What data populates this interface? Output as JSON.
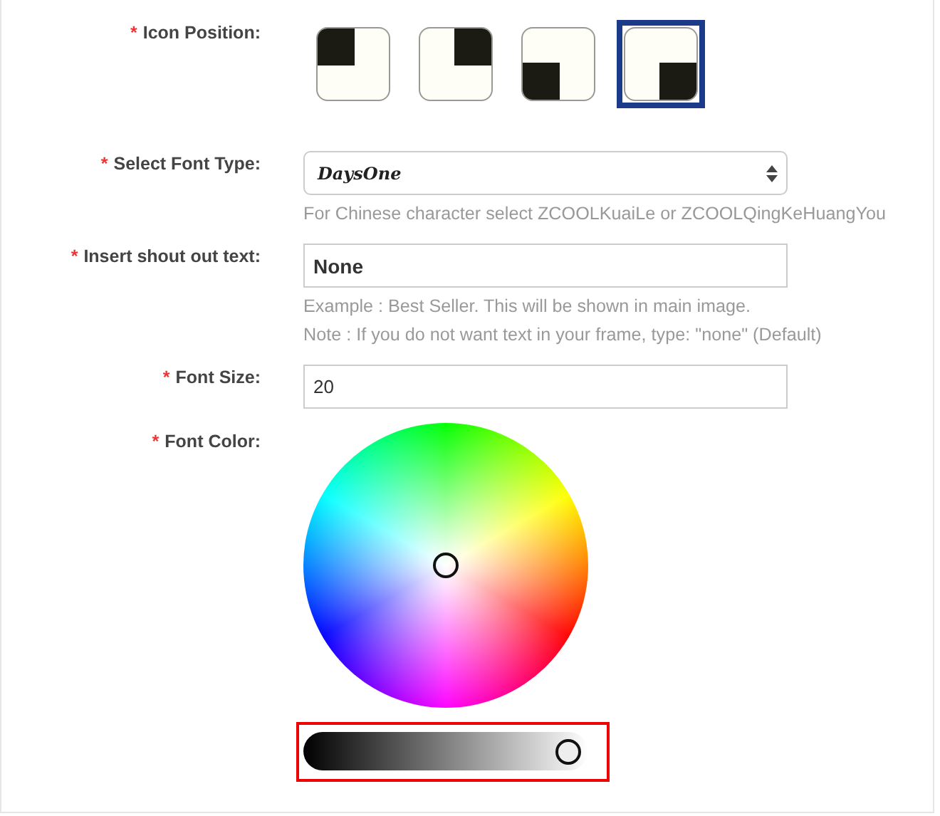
{
  "fields": [
    {
      "kind": "icon_position",
      "label": "Icon Position:",
      "required_mark": "*",
      "options": [
        {
          "kind": "top-left",
          "selected": false
        },
        {
          "kind": "top-right",
          "selected": false
        },
        {
          "kind": "bottom-left",
          "selected": false
        },
        {
          "kind": "bottom-right",
          "selected": true
        }
      ]
    },
    {
      "kind": "select",
      "label": "Select Font Type:",
      "required_mark": "*",
      "value": "DaysOne",
      "hints": [
        "For Chinese character select ZCOOLKuaiLe or ZCOOLQingKeHuangYou"
      ]
    },
    {
      "kind": "text",
      "label": "Insert shout out text:",
      "required_mark": "*",
      "value": "None",
      "bold": true,
      "hints": [
        "Example : Best Seller. This will be shown in main image.",
        "Note : If you do not want text in your frame, type: \"none\" (Default)"
      ]
    },
    {
      "kind": "text",
      "label": "Font Size:",
      "required_mark": "*",
      "value": "20",
      "bold": false
    },
    {
      "kind": "color",
      "label": "Font Color:",
      "required_mark": "*",
      "brightness": {
        "level": 0.93,
        "highlighted": true
      }
    }
  ]
}
